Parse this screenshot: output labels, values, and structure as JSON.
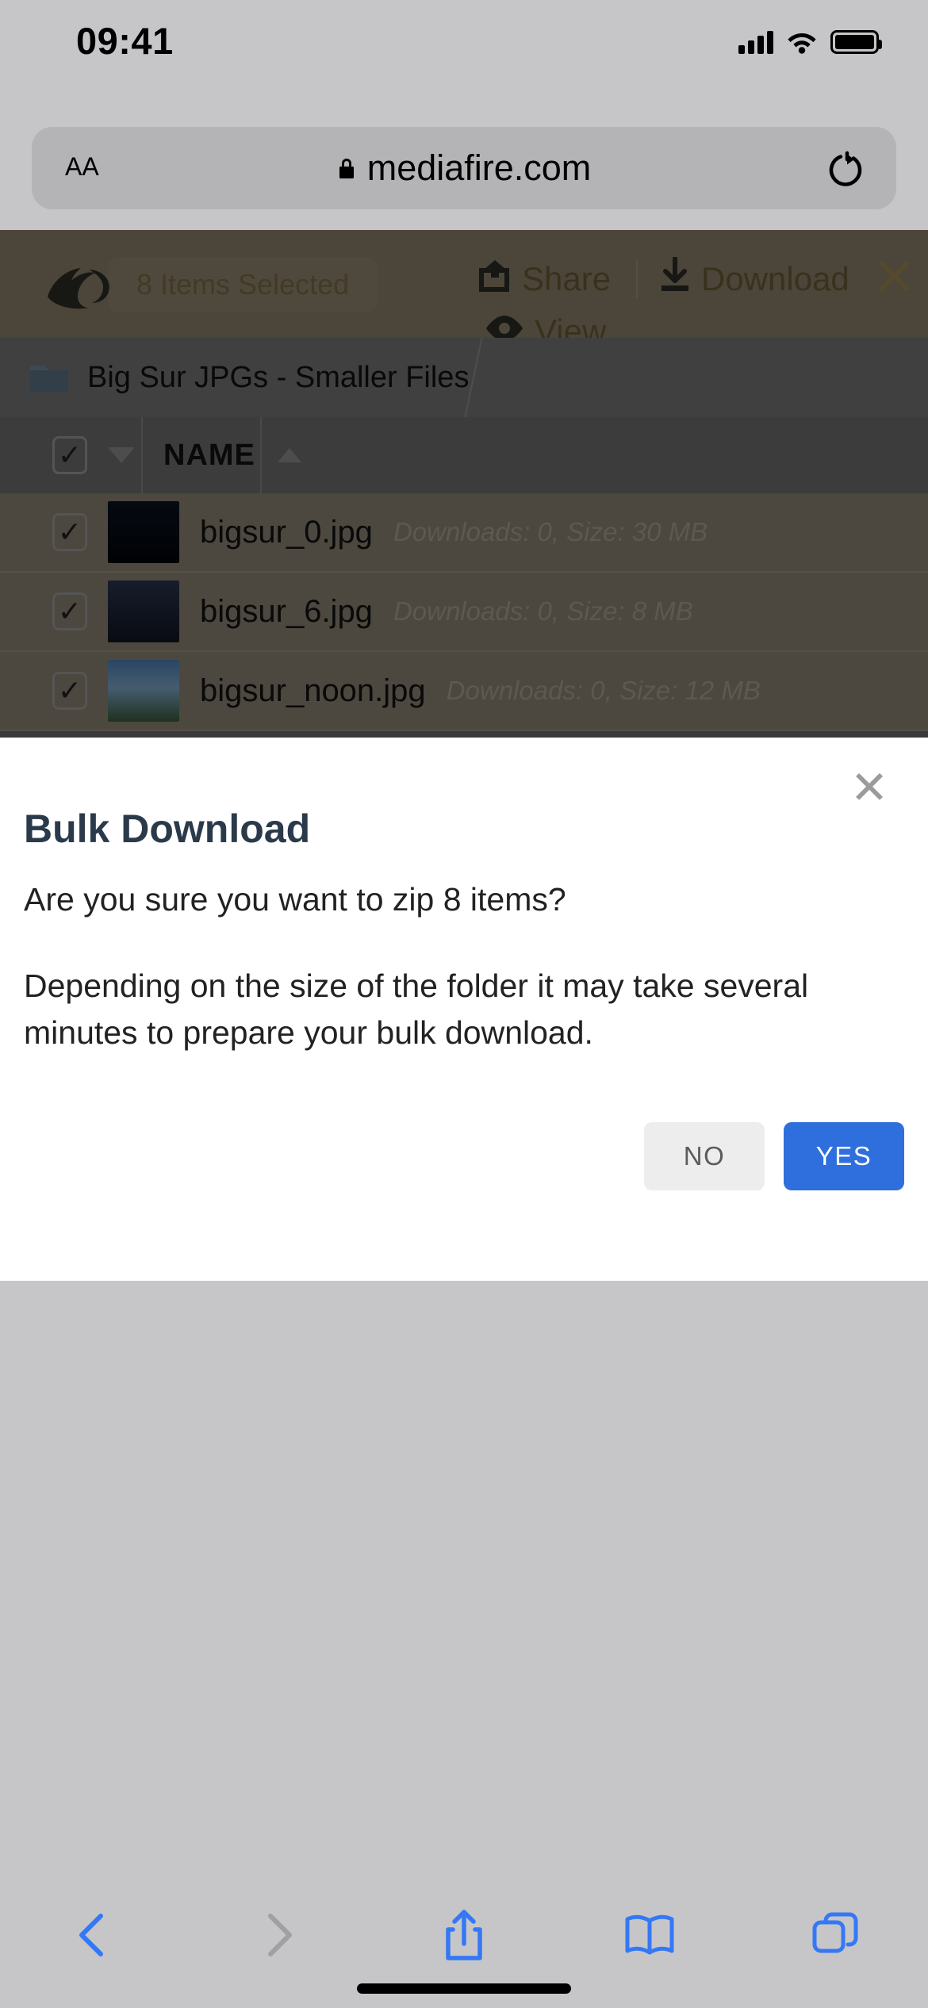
{
  "status_bar": {
    "time": "09:41",
    "signal_icon": "cellular-signal-icon",
    "wifi_icon": "wifi-icon",
    "battery_icon": "battery-icon"
  },
  "browser": {
    "url_bar": {
      "text_size_label": "AA",
      "lock_icon": "lock-icon",
      "url": "mediafire.com",
      "reload_icon": "reload-icon"
    },
    "bottom_bar": {
      "back_icon": "chevron-left-icon",
      "forward_icon": "chevron-right-icon",
      "share_icon": "share-icon",
      "bookmarks_icon": "book-icon",
      "tabs_icon": "tabs-icon"
    }
  },
  "page": {
    "toolbar": {
      "logo": "mediafire-flame-logo",
      "selection_label": "8 Items Selected",
      "share_label": "Share",
      "share_icon": "share-export-icon",
      "download_label": "Download",
      "download_icon": "download-arrow-icon",
      "view_label": "View",
      "view_icon": "eye-icon",
      "close_label": "✕"
    },
    "breadcrumb": {
      "folder_icon": "folder-icon",
      "label": "Big Sur JPGs - Smaller Files"
    },
    "table": {
      "select_all_checked": "✓",
      "sort_caret_down": "▼",
      "name_header": "NAME",
      "name_sort_asc": "▲",
      "rows": [
        {
          "checked": "✓",
          "name": "bigsur_0.jpg",
          "meta": "Downloads: 0, Size: 30 MB",
          "thumb_top": "#0b1220",
          "thumb_bottom": "#020408"
        },
        {
          "checked": "✓",
          "name": "bigsur_6.jpg",
          "meta": "Downloads: 0, Size: 8 MB",
          "thumb_top": "#2a3550",
          "thumb_bottom": "#10151f"
        },
        {
          "checked": "✓",
          "name": "bigsur_noon.jpg",
          "meta": "Downloads: 0, Size: 12 MB",
          "thumb_top": "#4b7fb5",
          "thumb_bottom": "#3b5a3a"
        }
      ]
    }
  },
  "modal": {
    "title": "Bulk Download",
    "close_label": "✕",
    "paragraph_1": "Are you sure you want to zip 8 items?",
    "paragraph_2": "Depending on the size of the folder it may take several minutes to prepare your bulk download.",
    "no_label": "NO",
    "yes_label": "YES",
    "yes_color": "#2f6fdd",
    "no_color": "#ededed"
  }
}
